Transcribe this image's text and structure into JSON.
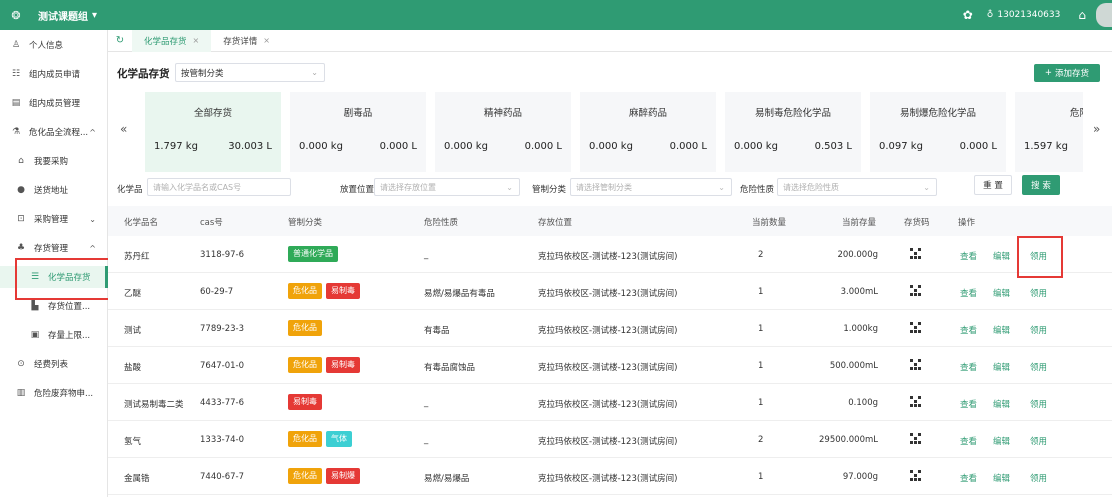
{
  "topbar": {
    "group": "测试课题组",
    "group_caret": "▾",
    "phone": "13021340633"
  },
  "sidebar": {
    "items": [
      {
        "label": "个人信息",
        "icon": "user-icon"
      },
      {
        "label": "组内成员申请",
        "icon": "member-apply-icon"
      },
      {
        "label": "组内成员管理",
        "icon": "member-manage-icon"
      },
      {
        "label": "危化品全流程...",
        "icon": "chemical-process-icon"
      },
      {
        "label": "我要采购",
        "icon": "home-icon"
      },
      {
        "label": "送货地址",
        "icon": "location-icon"
      },
      {
        "label": "采购管理",
        "icon": "purchase-icon"
      },
      {
        "label": "存货管理",
        "icon": "inventory-icon"
      },
      {
        "label": "化学品存货",
        "icon": "list-icon"
      },
      {
        "label": "存货位置...",
        "icon": "location-bar-icon"
      },
      {
        "label": "存量上限...",
        "icon": "limit-icon"
      },
      {
        "label": "经费列表",
        "icon": "funds-icon"
      },
      {
        "label": "危险废弃物申...",
        "icon": "waste-icon"
      }
    ]
  },
  "tabs": [
    {
      "label": "化学品存货",
      "close": "×"
    },
    {
      "label": "存货详情",
      "close": "×"
    }
  ],
  "page": {
    "title": "化学品存货",
    "category_select": "按管制分类",
    "add_button": "添加存货"
  },
  "stats": [
    {
      "title": "全部存货",
      "kg": "1.797 kg",
      "l": "30.003 L"
    },
    {
      "title": "剧毒品",
      "kg": "0.000 kg",
      "l": "0.000 L"
    },
    {
      "title": "精神药品",
      "kg": "0.000 kg",
      "l": "0.000 L"
    },
    {
      "title": "麻醉药品",
      "kg": "0.000 kg",
      "l": "0.000 L"
    },
    {
      "title": "易制毒危险化学品",
      "kg": "0.000 kg",
      "l": "0.503 L"
    },
    {
      "title": "易制爆危险化学品",
      "kg": "0.097 kg",
      "l": "0.000 L"
    },
    {
      "title": "危险",
      "kg": "1.597 kg",
      "l": ""
    }
  ],
  "filters": {
    "chem_label": "化学品",
    "chem_placeholder": "请输入化学品名或CAS号",
    "location_label": "放置位置",
    "location_placeholder": "请选择存放位置",
    "control_label": "管制分类",
    "control_placeholder": "请选择管制分类",
    "hazard_label": "危险性质",
    "hazard_placeholder": "请选择危险性质",
    "reset": "重 置",
    "search": "搜 索"
  },
  "table": {
    "headers": [
      "化学品名",
      "cas号",
      "管制分类",
      "危险性质",
      "存放位置",
      "当前数量",
      "当前存量",
      "存货码",
      "操作"
    ],
    "actions": {
      "view": "查看",
      "edit": "编辑",
      "claim": "领用"
    },
    "rows": [
      {
        "name": "苏丹红",
        "cas": "3118-97-6",
        "tags": [
          {
            "text": "普通化学品",
            "kind": "normal"
          }
        ],
        "hazard": "_",
        "location": "克拉玛依校区-测试楼-123(测试房间)",
        "qty": "2",
        "stock": "200.000g"
      },
      {
        "name": "乙醚",
        "cas": "60-29-7",
        "tags": [
          {
            "text": "危化品",
            "kind": "danger"
          },
          {
            "text": "易制毒",
            "kind": "drug"
          }
        ],
        "hazard": "易燃/易爆品有毒品",
        "location": "克拉玛依校区-测试楼-123(测试房间)",
        "qty": "1",
        "stock": "3.000mL"
      },
      {
        "name": "测试",
        "cas": "7789-23-3",
        "tags": [
          {
            "text": "危化品",
            "kind": "danger"
          }
        ],
        "hazard": "有毒品",
        "location": "克拉玛依校区-测试楼-123(测试房间)",
        "qty": "1",
        "stock": "1.000kg"
      },
      {
        "name": "盐酸",
        "cas": "7647-01-0",
        "tags": [
          {
            "text": "危化品",
            "kind": "danger"
          },
          {
            "text": "易制毒",
            "kind": "drug"
          }
        ],
        "hazard": "有毒品腐蚀品",
        "location": "克拉玛依校区-测试楼-123(测试房间)",
        "qty": "1",
        "stock": "500.000mL"
      },
      {
        "name": "测试易制毒二类",
        "cas": "4433-77-6",
        "tags": [
          {
            "text": "易制毒",
            "kind": "drug"
          }
        ],
        "hazard": "_",
        "location": "克拉玛依校区-测试楼-123(测试房间)",
        "qty": "1",
        "stock": "0.100g"
      },
      {
        "name": "氢气",
        "cas": "1333-74-0",
        "tags": [
          {
            "text": "危化品",
            "kind": "danger"
          },
          {
            "text": "气体",
            "kind": "gas"
          }
        ],
        "hazard": "_",
        "location": "克拉玛依校区-测试楼-123(测试房间)",
        "qty": "2",
        "stock": "29500.000mL"
      },
      {
        "name": "金属锆",
        "cas": "7440-67-7",
        "tags": [
          {
            "text": "危化品",
            "kind": "danger"
          },
          {
            "text": "易制爆",
            "kind": "drug"
          }
        ],
        "hazard": "易燃/易爆品",
        "location": "克拉玛依校区-测试楼-123(测试房间)",
        "qty": "1",
        "stock": "97.000g"
      }
    ]
  }
}
